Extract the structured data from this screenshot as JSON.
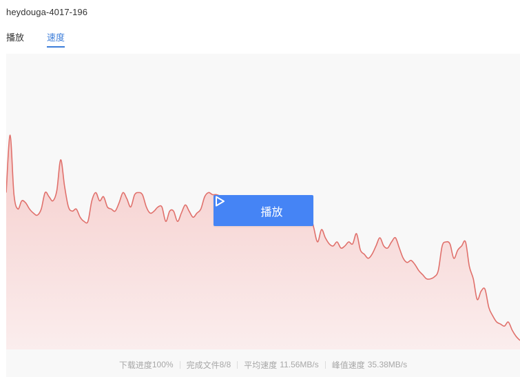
{
  "title": "heydouga-4017-196",
  "tabs": [
    {
      "label": "播放",
      "active": false
    },
    {
      "label": "速度",
      "active": true
    }
  ],
  "play_button": {
    "label": "播放",
    "icon": "play-icon"
  },
  "stats": {
    "progress_label": "下载进度",
    "progress_value": "100%",
    "files_label": "完成文件",
    "files_value": "8/8",
    "avg_label": "平均速度",
    "avg_value": "11.56MB/s",
    "peak_label": "峰值速度",
    "peak_value": "35.38MB/s"
  },
  "colors": {
    "accent": "#3c7dd9",
    "button": "#4584f5",
    "line": "#e0706b",
    "fill_top": "#f5c6c4",
    "fill_bottom": "#fbecec"
  },
  "chart_data": {
    "type": "area",
    "title": "",
    "xlabel": "",
    "ylabel": "",
    "grid": false,
    "peak": "35.38MB/s",
    "values": [
      72,
      100,
      71,
      64,
      68,
      67,
      64,
      62,
      61,
      64,
      72,
      70,
      68,
      73,
      88,
      75,
      65,
      63,
      64,
      60,
      58,
      58,
      68,
      72,
      68,
      70,
      65,
      64,
      63,
      67,
      72,
      69,
      65,
      71,
      72,
      71,
      65,
      62,
      63,
      65,
      65,
      58,
      63,
      63,
      58,
      62,
      66,
      63,
      60,
      62,
      64,
      70,
      72,
      71,
      71,
      70,
      66,
      68,
      62,
      64,
      69,
      66,
      67,
      64,
      67,
      63,
      59,
      61,
      63,
      65,
      62,
      60,
      63,
      67,
      64,
      60,
      66,
      67,
      63,
      55,
      48,
      54,
      50,
      47,
      46,
      48,
      45,
      46,
      48,
      47,
      52,
      44,
      42,
      40,
      42,
      46,
      50,
      46,
      45,
      48,
      50,
      45,
      40,
      38,
      39,
      37,
      34,
      32,
      30,
      30,
      31,
      34,
      46,
      48,
      47,
      40,
      44,
      46,
      48,
      36,
      30,
      20,
      24,
      25,
      16,
      12,
      9,
      8,
      7,
      9,
      5,
      2,
      0
    ]
  }
}
